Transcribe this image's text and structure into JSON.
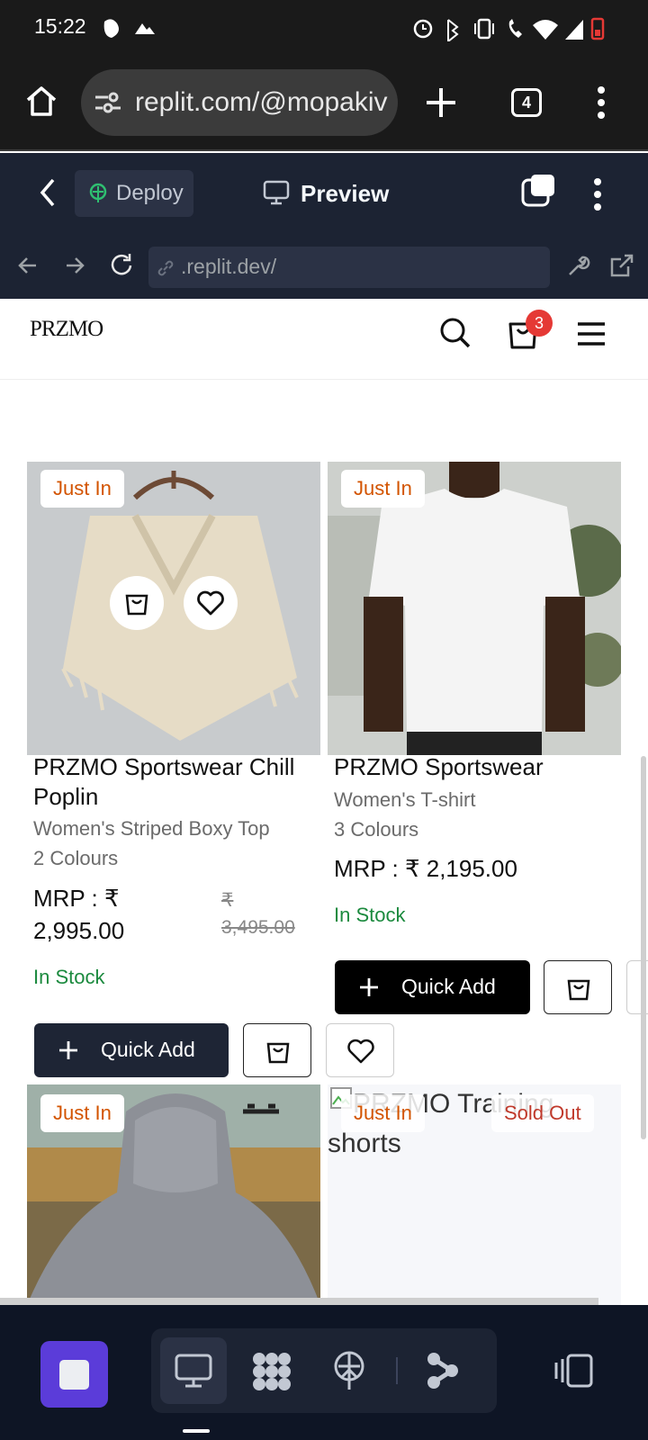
{
  "status_bar": {
    "time": "15:22"
  },
  "browser": {
    "url": "replit.com/@mopakiv",
    "tab_count": "4"
  },
  "replit": {
    "deploy_label": "Deploy",
    "preview_label": "Preview",
    "dev_url": ".replit.dev/"
  },
  "site": {
    "logo": "PRZMO",
    "cart_count": "3",
    "products": [
      {
        "tag": "Just In",
        "name": "PRZMO Sportswear Chill Poplin",
        "subtitle": "Women's Striped Boxy Top",
        "colours": "2 Colours",
        "price": "MRP : ₹ 2,995.00",
        "old_price": "₹ 3,495.00",
        "stock": "In Stock",
        "quick_add": "Quick Add"
      },
      {
        "tag": "Just In",
        "name": "PRZMO Sportswear",
        "subtitle": "Women's T-shirt",
        "colours": "3 Colours",
        "price": "MRP : ₹ 2,195.00",
        "stock": "In Stock",
        "quick_add": "Quick Add"
      },
      {
        "tag": "Just In"
      },
      {
        "tag": "Just In",
        "sold_out": "Sold Out",
        "image_alt": "PRZMO Training shorts"
      }
    ]
  },
  "colors": {
    "accent": "#5b3cd9",
    "in_stock": "#1b8a3e",
    "tag": "#d35400",
    "cart_badge": "#e53935"
  }
}
